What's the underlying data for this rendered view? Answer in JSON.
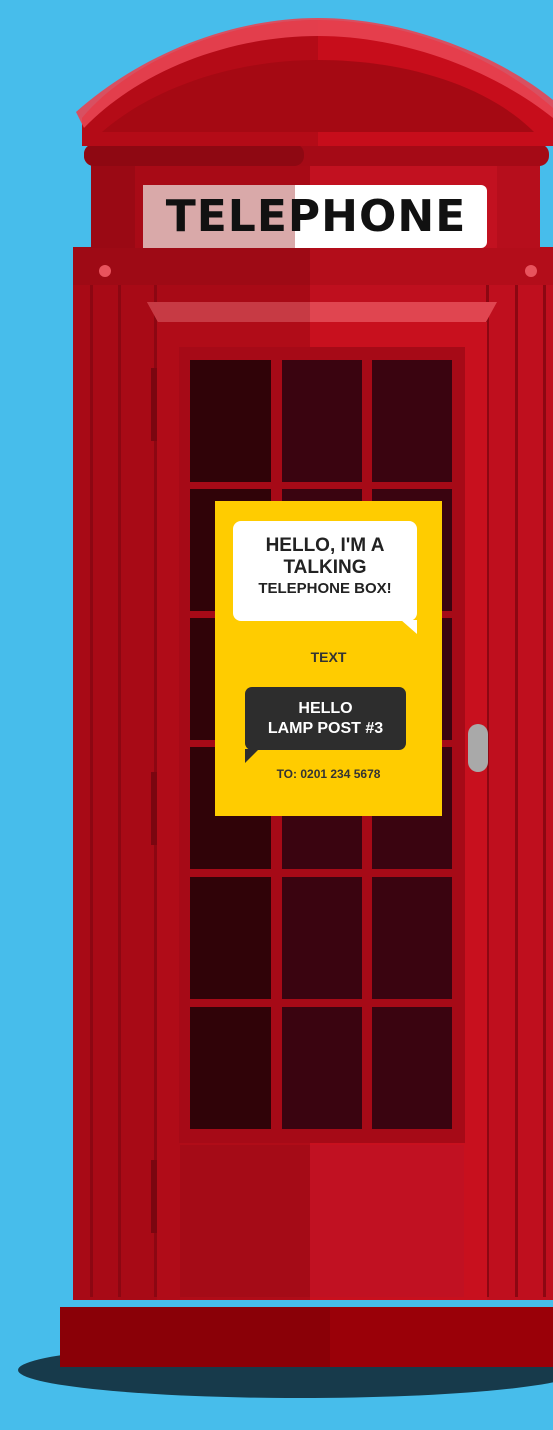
{
  "scene": {
    "background_color": "#47bdeb",
    "booth_color": "#c8101e",
    "sign": {
      "text": "TELEPHONE"
    }
  },
  "poster": {
    "speech_bubble": {
      "line1": "HELLO, I'M A",
      "line2": "TALKING",
      "line3": "TELEPHONE BOX!"
    },
    "label": "TEXT",
    "message_bubble": {
      "line1": "HELLO",
      "line2": "LAMP POST #3"
    },
    "to_line": "TO: 0201 234 5678"
  }
}
